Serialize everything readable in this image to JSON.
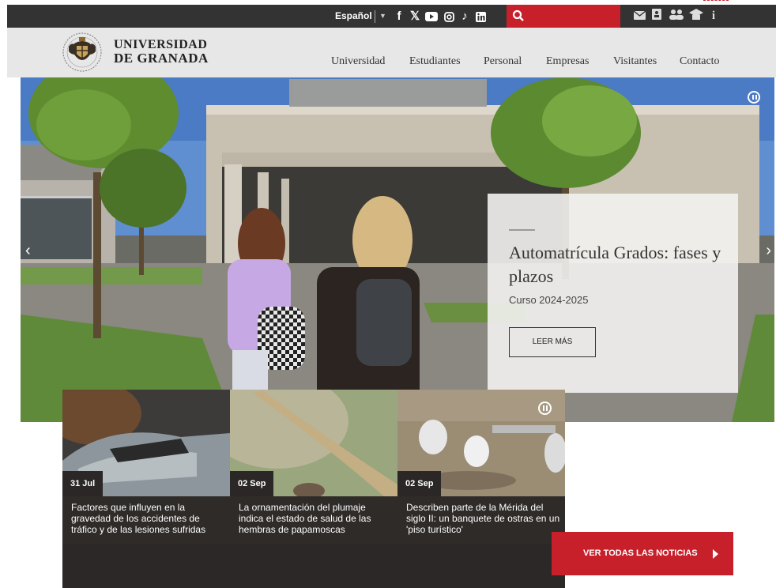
{
  "topbar": {
    "language": "Español",
    "social_icons": [
      "facebook-icon",
      "x-icon",
      "youtube-icon",
      "instagram-icon",
      "tiktok-icon",
      "linkedin-icon"
    ],
    "right_icons": [
      "mail-icon",
      "directory-icon",
      "people-icon",
      "school-icon",
      "info-icon"
    ],
    "accent": "#c8202b"
  },
  "header": {
    "logo_line1": "UNIVERSIDAD",
    "logo_line2": "DE GRANADA",
    "nav": [
      "Universidad",
      "Estudiantes",
      "Personal",
      "Empresas",
      "Visitantes",
      "Contacto"
    ]
  },
  "hero": {
    "title": "Automatrícula Grados: fases y plazos",
    "subtitle": "Curso 2024-2025",
    "button": "LEER MÁS"
  },
  "news": [
    {
      "date": "31 Jul",
      "text": "Factores que influyen en la gravedad de los accidentes de tráfico y de las lesiones sufridas"
    },
    {
      "date": "02 Sep",
      "text": "La ornamentación del plumaje indica el estado de salud de las hembras de papamoscas"
    },
    {
      "date": "02 Sep",
      "text": "Describen parte de la Mérida del siglo II: un banquete de ostras en un 'piso turístico'"
    }
  ],
  "all_news_button": "VER TODAS LAS NOTICIAS"
}
